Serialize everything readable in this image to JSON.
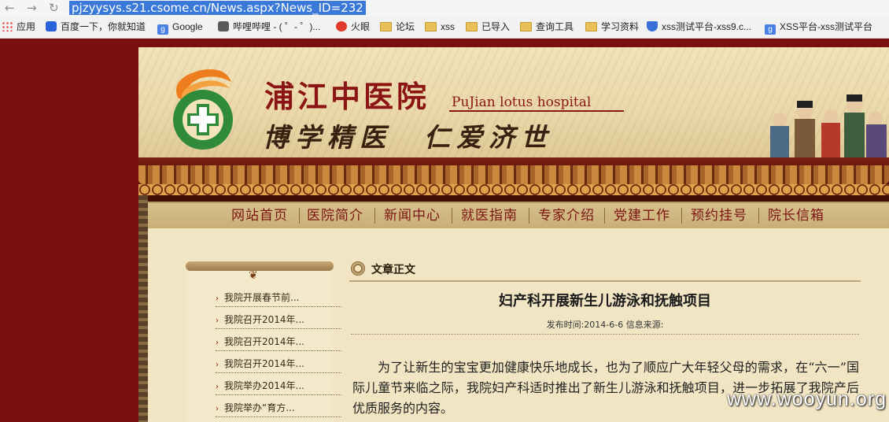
{
  "browser": {
    "url": "pjzyysys.s21.csome.cn/News.aspx?News_ID=232",
    "bookmarks": [
      {
        "label": "应用",
        "icon": "apps-grid-icon"
      },
      {
        "label": "百度一下，你就知道",
        "icon": "baidu-paw-icon"
      },
      {
        "label": "Google",
        "icon": "google-icon"
      },
      {
        "label": "哔哩哔哩 - ( ゜- ゜)...",
        "icon": "bilibili-icon"
      },
      {
        "label": "火眼",
        "icon": "fireeye-icon"
      },
      {
        "label": "论坛",
        "icon": "folder-icon"
      },
      {
        "label": "xss",
        "icon": "folder-icon"
      },
      {
        "label": "已导入",
        "icon": "folder-icon"
      },
      {
        "label": "查询工具",
        "icon": "folder-icon"
      },
      {
        "label": "学习资料",
        "icon": "folder-icon"
      },
      {
        "label": "xss测试平台-xss9.c...",
        "icon": "shield-icon"
      },
      {
        "label": "XSS平台-xss测试平台",
        "icon": "google-icon"
      }
    ]
  },
  "site": {
    "name": "浦江中医院",
    "name_en": "PuJian lotus hospital",
    "slogan": "博学精医　仁爱济世",
    "nav": [
      "网站首页",
      "医院简介",
      "新闻中心",
      "就医指南",
      "专家介绍",
      "党建工作",
      "预约挂号",
      "院长信箱"
    ]
  },
  "sidebar": {
    "items": [
      "我院开展春节前...",
      "我院召开2014年...",
      "我院召开2014年...",
      "我院召开2014年...",
      "我院举办2014年...",
      "我院举办“育方..."
    ]
  },
  "article": {
    "section_title": "文章正文",
    "title": "妇产科开展新生儿游泳和抚触项目",
    "meta": "发布时间:2014-6-6 信息来源:",
    "body": "为了让新生的宝宝更加健康快乐地成长，也为了顺应广大年轻父母的需求，在“六一”国际儿童节来临之际，我院妇产科适时推出了新生儿游泳和抚触项目，进一步拓展了我院产后优质服务的内容。"
  },
  "watermark": "www.wooyun.org"
}
